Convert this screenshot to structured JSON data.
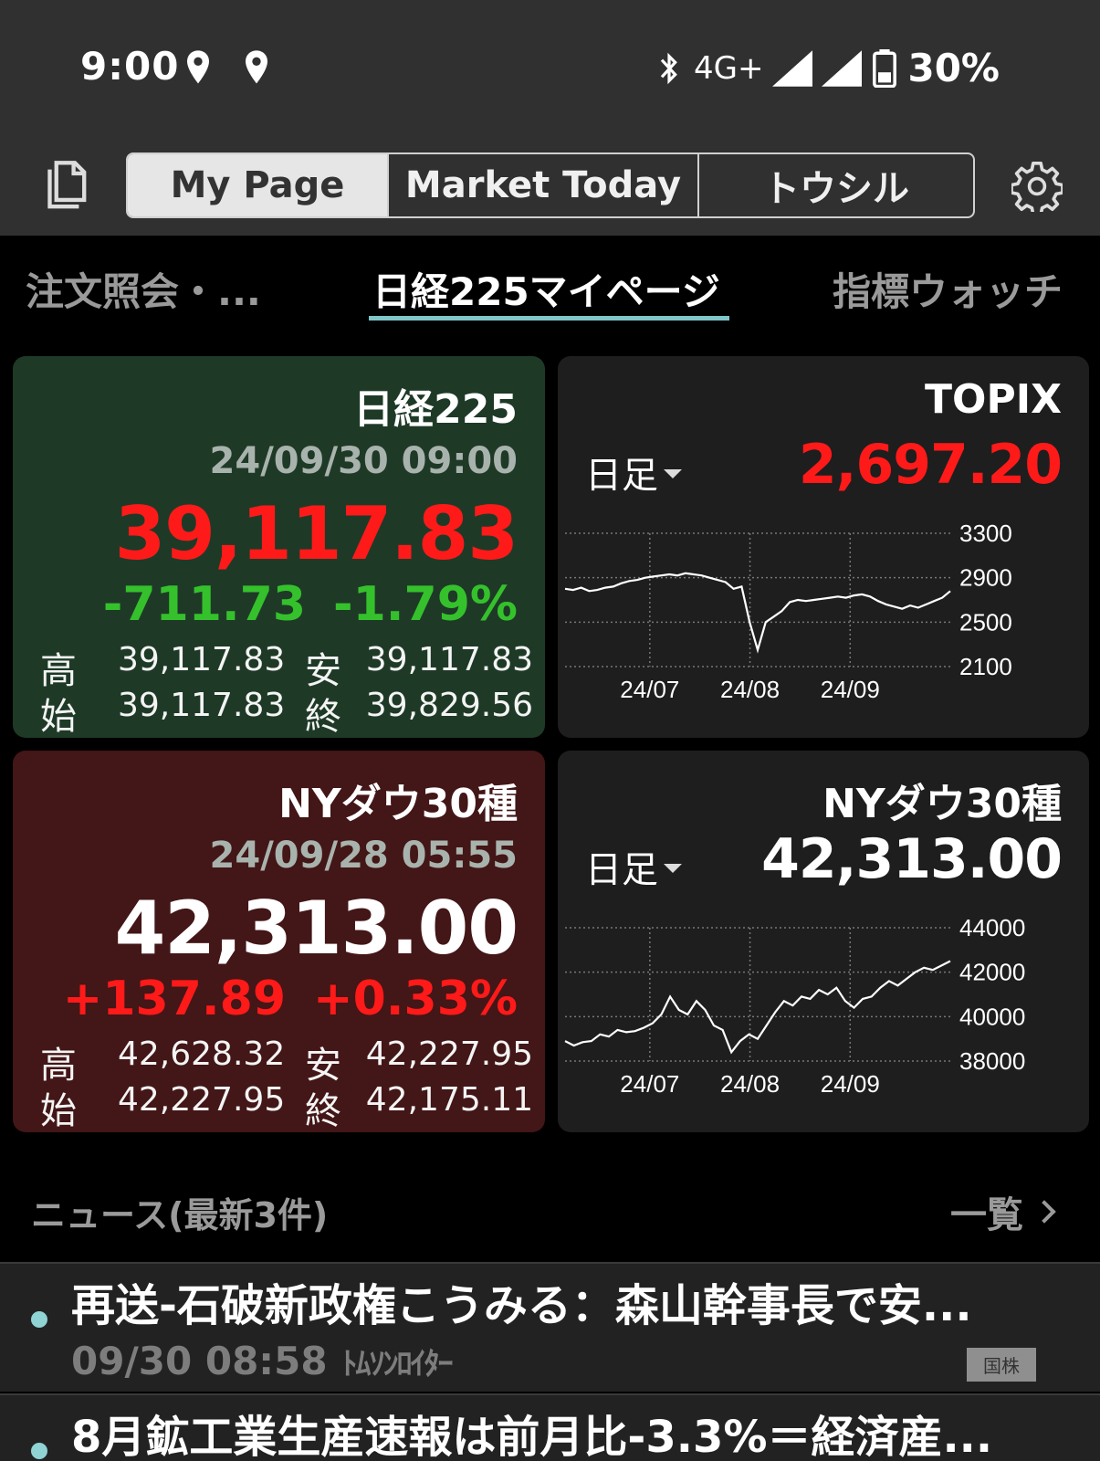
{
  "status": {
    "time": "9:00",
    "network": "4G+",
    "battery": "30%"
  },
  "header": {
    "tabs": [
      {
        "label": "My Page",
        "active": true
      },
      {
        "label": "Market Today",
        "active": false
      },
      {
        "label": "トウシル",
        "active": false
      }
    ]
  },
  "subtabs": {
    "left": "注文照会・...",
    "center": "日経225マイページ",
    "right": "指標ウォッチ"
  },
  "cards": {
    "nikkei": {
      "title": "日経225",
      "datetime": "24/09/30 09:00",
      "price": "39,117.83",
      "change": "-711.73",
      "change_pct": "-1.79%",
      "high_label": "高",
      "high": "39,117.83",
      "low_label": "安",
      "low": "39,117.83",
      "open_label": "始",
      "open": "39,117.83",
      "close_label": "終",
      "close": "39,829.56"
    },
    "topix": {
      "title": "TOPIX",
      "timeframe": "日足",
      "price": "2,697.20"
    },
    "dow": {
      "title": "NYダウ30種",
      "datetime": "24/09/28 05:55",
      "price": "42,313.00",
      "change": "+137.89",
      "change_pct": "+0.33%",
      "high_label": "高",
      "high": "42,628.32",
      "low_label": "安",
      "low": "42,227.95",
      "open_label": "始",
      "open": "42,227.95",
      "close_label": "終",
      "close": "42,175.11"
    },
    "dow_chart": {
      "title": "NYダウ30種",
      "timeframe": "日足",
      "price": "42,313.00"
    }
  },
  "colors": {
    "up": "#ff1a1a",
    "down": "#35c12c",
    "accent": "#7fc6c8"
  },
  "chart_data": [
    {
      "type": "line",
      "title": "TOPIX",
      "x_ticks": [
        "24/07",
        "24/08",
        "24/09"
      ],
      "y_ticks": [
        3300,
        2900,
        2500,
        2100
      ],
      "ylim": [
        2100,
        3300
      ],
      "series": [
        {
          "values": [
            2800,
            2790,
            2810,
            2780,
            2790,
            2810,
            2820,
            2850,
            2870,
            2880,
            2900,
            2910,
            2920,
            2930,
            2920,
            2940,
            2930,
            2920,
            2900,
            2880,
            2860,
            2800,
            2820,
            2500,
            2250,
            2500,
            2550,
            2600,
            2680,
            2700,
            2690,
            2700,
            2710,
            2720,
            2730,
            2720,
            2740,
            2750,
            2730,
            2690,
            2660,
            2640,
            2620,
            2650,
            2630,
            2660,
            2690,
            2720,
            2780
          ]
        }
      ]
    },
    {
      "type": "line",
      "title": "NYダウ30種",
      "x_ticks": [
        "24/07",
        "24/08",
        "24/09"
      ],
      "y_ticks": [
        44000,
        42000,
        40000,
        38000
      ],
      "ylim": [
        38000,
        44000
      ],
      "series": [
        {
          "values": [
            38900,
            38700,
            38850,
            38900,
            39200,
            39100,
            39400,
            39300,
            39350,
            39500,
            39700,
            40100,
            40900,
            40300,
            40100,
            40700,
            40300,
            39600,
            39400,
            38400,
            38900,
            39200,
            39000,
            39600,
            40200,
            40700,
            40500,
            40900,
            40800,
            41200,
            41000,
            41300,
            40700,
            40400,
            40800,
            40900,
            41300,
            41600,
            41400,
            41700,
            42000,
            42200,
            42100,
            42300,
            42500
          ]
        }
      ]
    }
  ],
  "news": {
    "heading": "ニュース(最新3件)",
    "more": "一覧",
    "items": [
      {
        "title": "再送-石破新政権こうみる：森山幹事長で安...",
        "time": "09/30 08:58",
        "source": "ﾄﾑｿﾝﾛｲﾀｰ",
        "tag": "国株"
      },
      {
        "title": "8月鉱工業生産速報は前月比-3.3%＝経済産..."
      }
    ]
  }
}
